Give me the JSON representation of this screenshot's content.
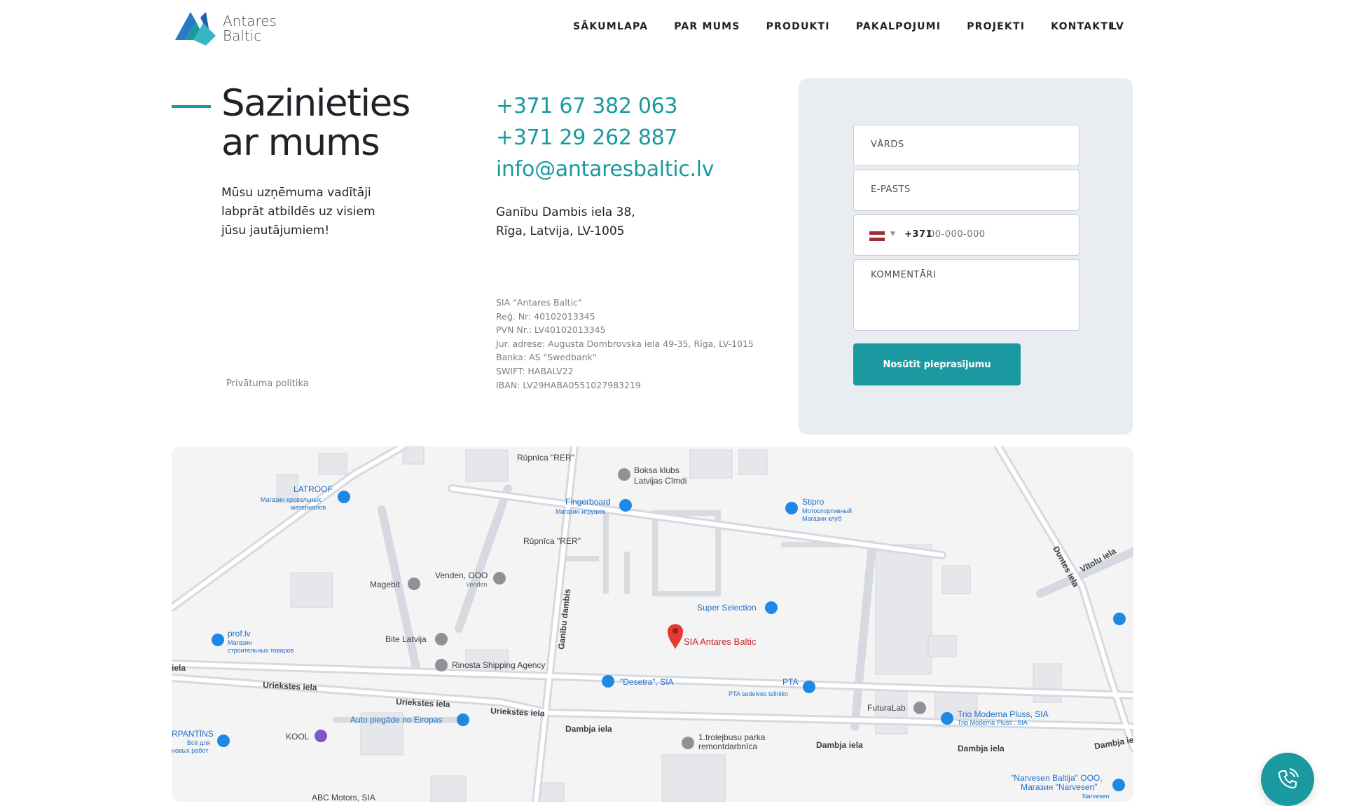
{
  "brand": {
    "name_line1": "Antares",
    "name_line2": "Baltic"
  },
  "nav": {
    "items": [
      "SĀKUMLAPA",
      "PAR MUMS",
      "PRODUKTI",
      "PAKALPOJUMI",
      "PROJEKTI",
      "KONTAKTI"
    ],
    "language": "LV"
  },
  "contact": {
    "heading_line1": "Sazinieties",
    "heading_line2": "ar mums",
    "intro_lines": [
      "Mūsu uzņēmuma vadītāji",
      "labprāt atbildēs uz visiem",
      "jūsu jautājumiem!"
    ],
    "privacy_link": "Privātuma politika",
    "phone1": "+371 67 382 063",
    "phone2": "+371 29 262 887",
    "email": "info@antaresbaltic.lv",
    "address_line1": "Ganību Dambis iela 38,",
    "address_line2": "Rīga, Latvija, LV-1005",
    "legal": [
      "SIA \"Antares Baltic\"",
      "Reģ. Nr: 40102013345",
      "PVN Nr.: LV40102013345",
      "Jur. adrese: Augusta Dombrovska iela 49-35, Rīga, LV-1015",
      "Banka: AS \"Swedbank\"",
      "SWIFT: HABALV22",
      "IBAN: LV29HABA0551027983219"
    ]
  },
  "form": {
    "name_placeholder": "VĀRDS",
    "email_placeholder": "E-PASTS",
    "phone_dial_code": "+371",
    "phone_placeholder": "00-000-000",
    "comment_placeholder": "KOMMENTĀRI",
    "submit_label": "Nosūtīt pieprasījumu"
  },
  "map": {
    "marker_label": "SIA Antares Baltic",
    "places": [
      "Rūpnīca \"RER\"",
      "Boksa klubs",
      "Latvijas Cīmdi",
      "LATROOF",
      "Магазин кровельных",
      "материалов",
      "Fingerboard",
      "Магазин игрушек",
      "Stipro",
      "Мотоспортивный",
      "Магазин клуб",
      "Rūpnīca \"RER\"",
      "Magebit",
      "Venden, OOO",
      "Venden",
      "Super Selection",
      "prof.lv",
      "Магазин",
      "строительных товаров",
      "Bite Latvija",
      "Rinosta Shipping Agency",
      "\"Desetra\", SIA",
      "PTA",
      "PTA sedeives telinikn",
      "FuturaLab",
      "Trio Moderna Pluss, SIA",
      "Trio Moderna Pluss , SIA",
      "Auto piegāde no Eiropas",
      "KOOL",
      "RPANTĪNS",
      "Всё для",
      "новых работ",
      "1.trolejbusu parka",
      "remontdarbnīca",
      "\"Narvesen Baltija\" OOO,",
      "Магазин \"Narvesen\"",
      "Narvesen",
      "ABC Motors, SIA"
    ],
    "streets": [
      "Ganību dambis",
      "Uriekstes iela",
      "Uriekstes iela",
      "Uriekstes iela",
      "Dambja iela",
      "Dambja iela",
      "Dambja iela",
      "Dambja iela",
      "Duntes iela",
      "Vītolu iela",
      "iela",
      "iela",
      "Dun"
    ]
  },
  "colors": {
    "accent": "#1a9aa0",
    "form_bg": "#e9ecf1",
    "marker": "#e53935",
    "poi_blue": "#1e88e5",
    "poi_gray": "#8e9297"
  }
}
